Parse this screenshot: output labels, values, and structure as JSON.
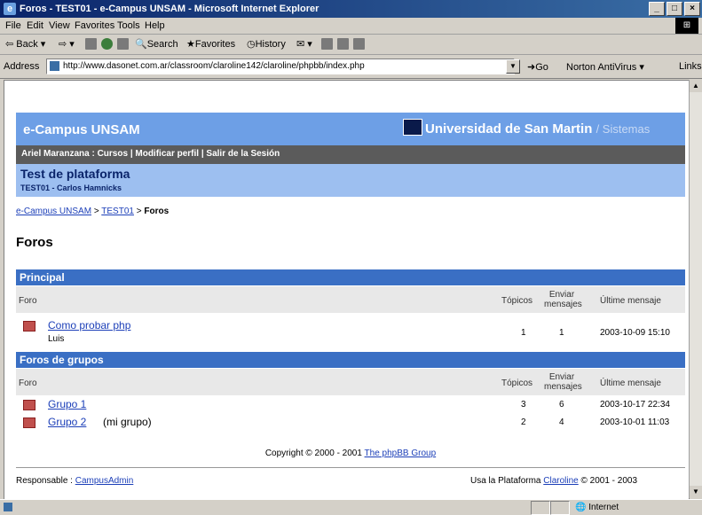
{
  "window": {
    "title": "Foros - TEST01 - e-Campus UNSAM - Microsoft Internet Explorer",
    "controls": [
      "_",
      "□",
      "×"
    ]
  },
  "menubar": [
    "File",
    "Edit",
    "View",
    "Favorites",
    "Tools",
    "Help"
  ],
  "toolbar": {
    "back": "Back",
    "search": "Search",
    "favorites": "Favorites",
    "history": "History"
  },
  "addressbar": {
    "label": "Address",
    "url": "http://www.dasonet.com.ar/classroom/claroline142/claroline/phpbb/index.php",
    "go": "Go",
    "norton": "Norton AntiVirus",
    "links": "Links"
  },
  "header": {
    "campus": "e-Campus UNSAM",
    "university": "Universidad de San Martin",
    "sistemas": "/ Sistemas"
  },
  "userbar": {
    "text": "Ariel Maranzana : Cursos | Modificar perfil | Salir de la Sesión"
  },
  "course": {
    "title": "Test de plataforma",
    "subtitle": "TEST01 - Carlos Hamnicks"
  },
  "breadcrumb": {
    "home": "e-Campus UNSAM",
    "course": "TEST01",
    "current": "Foros",
    "separator": ">"
  },
  "page_title": "Foros",
  "sections": [
    {
      "name": "Principal",
      "columns": {
        "foro": "Foro",
        "topicos": "Tópicos",
        "enviar": "Enviar",
        "mensajes": "mensajes",
        "ultimo": "Últime mensaje"
      },
      "forums": [
        {
          "name": "Como probar php",
          "extra": "",
          "sub": "Luis",
          "topics": "1",
          "messages": "1",
          "last": "2003-10-09 15:10"
        }
      ]
    },
    {
      "name": "Foros de grupos",
      "columns": {
        "foro": "Foro",
        "topicos": "Tópicos",
        "enviar": "Enviar",
        "mensajes": "mensajes",
        "ultimo": "Últime mensaje"
      },
      "forums": [
        {
          "name": "Grupo 1",
          "extra": "",
          "sub": "",
          "topics": "3",
          "messages": "6",
          "last": "2003-10-17 22:34"
        },
        {
          "name": "Grupo 2",
          "extra": "(mi grupo)",
          "sub": "",
          "topics": "2",
          "messages": "4",
          "last": "2003-10-01 11:03"
        }
      ]
    }
  ],
  "footer": {
    "copyright": "Copyright © 2000 - 2001",
    "phpbb": "The phpBB Group",
    "responsable_label": "Responsable :",
    "responsable": "CampusAdmin",
    "usa_prefix": "Usa la Plataforma",
    "claroline": "Claroline",
    "usa_suffix": "© 2001 - 2003"
  },
  "statusbar": {
    "zone": "Internet"
  }
}
